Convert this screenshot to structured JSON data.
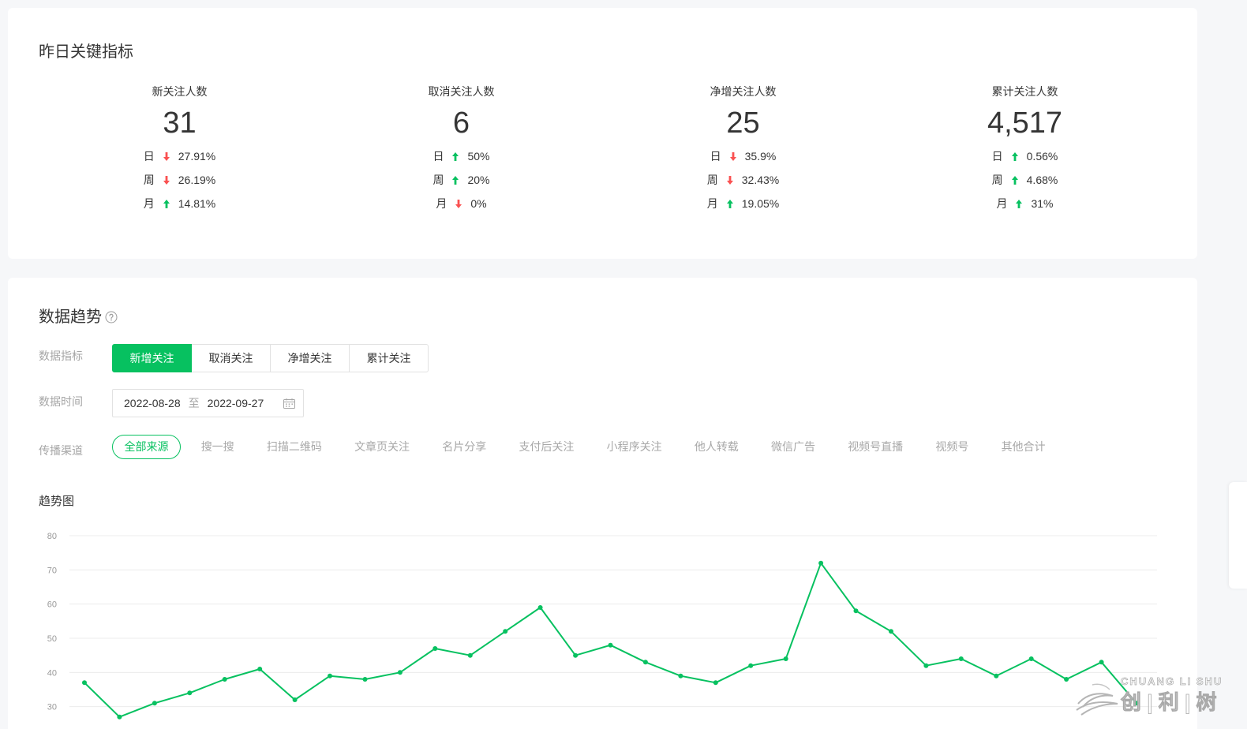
{
  "key_metrics": {
    "title": "昨日关键指标",
    "items": [
      {
        "label": "新关注人数",
        "value": "31",
        "changes": [
          {
            "period": "日",
            "arrow": "arrow-down-icon",
            "pct": "27.91%"
          },
          {
            "period": "周",
            "arrow": "arrow-down-icon",
            "pct": "26.19%"
          },
          {
            "period": "月",
            "arrow": "arrow-up-icon",
            "pct": "14.81%"
          }
        ]
      },
      {
        "label": "取消关注人数",
        "value": "6",
        "changes": [
          {
            "period": "日",
            "arrow": "arrow-up-icon",
            "pct": "50%"
          },
          {
            "period": "周",
            "arrow": "arrow-up-icon",
            "pct": "20%"
          },
          {
            "period": "月",
            "arrow": "arrow-down-icon",
            "pct": "0%"
          }
        ]
      },
      {
        "label": "净增关注人数",
        "value": "25",
        "changes": [
          {
            "period": "日",
            "arrow": "arrow-down-icon",
            "pct": "35.9%"
          },
          {
            "period": "周",
            "arrow": "arrow-down-icon",
            "pct": "32.43%"
          },
          {
            "period": "月",
            "arrow": "arrow-up-icon",
            "pct": "19.05%"
          }
        ]
      },
      {
        "label": "累计关注人数",
        "value": "4,517",
        "changes": [
          {
            "period": "日",
            "arrow": "arrow-up-icon",
            "pct": "0.56%"
          },
          {
            "period": "周",
            "arrow": "arrow-up-icon",
            "pct": "4.68%"
          },
          {
            "period": "月",
            "arrow": "arrow-up-icon",
            "pct": "31%"
          }
        ]
      }
    ]
  },
  "trend": {
    "title": "数据趋势",
    "help_icon": "question-circle-icon",
    "metric_filter": {
      "label": "数据指标",
      "options": [
        {
          "label": "新增关注",
          "active": true
        },
        {
          "label": "取消关注",
          "active": false
        },
        {
          "label": "净增关注",
          "active": false
        },
        {
          "label": "累计关注",
          "active": false
        }
      ]
    },
    "date_filter": {
      "label": "数据时间",
      "start": "2022-08-28",
      "separator": "至",
      "end": "2022-09-27",
      "icon": "calendar-icon"
    },
    "channel_filter": {
      "label": "传播渠道",
      "options": [
        {
          "label": "全部来源",
          "active": true
        },
        {
          "label": "搜一搜",
          "active": false
        },
        {
          "label": "扫描二维码",
          "active": false
        },
        {
          "label": "文章页关注",
          "active": false
        },
        {
          "label": "名片分享",
          "active": false
        },
        {
          "label": "支付后关注",
          "active": false
        },
        {
          "label": "小程序关注",
          "active": false
        },
        {
          "label": "他人转载",
          "active": false
        },
        {
          "label": "微信广告",
          "active": false
        },
        {
          "label": "视频号直播",
          "active": false
        },
        {
          "label": "视频号",
          "active": false
        },
        {
          "label": "其他合计",
          "active": false
        }
      ]
    }
  },
  "colors": {
    "accent": "#07c160",
    "up": "#07c160",
    "down": "#fa5151",
    "text": "#353535",
    "muted": "#a6a6a6"
  },
  "watermark": {
    "latin": "CHUANG LI SHU",
    "cjk": "创 | 利 | 树"
  },
  "chart_data": {
    "type": "line",
    "title": "趋势图",
    "values": [
      37,
      27,
      31,
      34,
      38,
      41,
      32,
      39,
      38,
      40,
      47,
      45,
      52,
      59,
      45,
      48,
      43,
      39,
      37,
      42,
      44,
      72,
      58,
      52,
      42,
      44,
      39,
      44,
      38,
      43,
      31
    ],
    "y_ticks": [
      80,
      70,
      60,
      50,
      40,
      30
    ],
    "ylim": [
      20,
      80
    ],
    "grid": true,
    "color": "#07c160"
  }
}
